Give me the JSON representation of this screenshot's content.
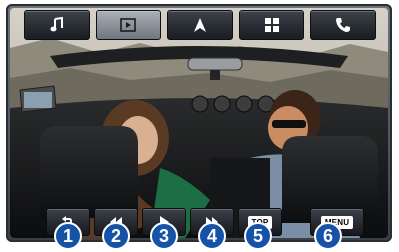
{
  "top_menu": {
    "items": [
      {
        "icon": "music-note-icon",
        "active": false
      },
      {
        "icon": "video-play-icon",
        "active": true
      },
      {
        "icon": "navigation-arrow-icon",
        "active": false
      },
      {
        "icon": "grid-menu-icon",
        "active": false
      },
      {
        "icon": "phone-icon",
        "active": false
      }
    ]
  },
  "playback_controls": {
    "return_icon": "return-icon",
    "rewind_icon": "rewind-icon",
    "play_icon": "play-icon",
    "fast_forward_icon": "fast-forward-icon",
    "top_label": "TOP",
    "menu_label": "MENU"
  },
  "callouts": [
    "1",
    "2",
    "3",
    "4",
    "5",
    "6"
  ],
  "colors": {
    "callout": "#1652a8",
    "active_button": "#9aa2aa",
    "button": "#22262b"
  }
}
